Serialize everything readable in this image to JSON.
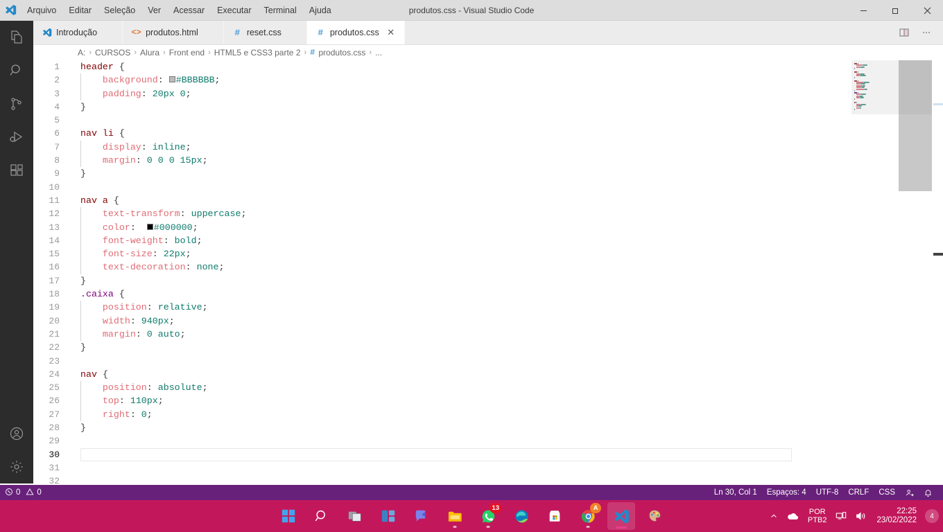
{
  "window": {
    "title": "produtos.css - Visual Studio Code",
    "logo_icon": "vscode-logo-icon",
    "minimize_label": "—",
    "maximize_icon": "maximize-icon",
    "close_label": "✕"
  },
  "menubar": {
    "items": [
      {
        "label": "Arquivo"
      },
      {
        "label": "Editar"
      },
      {
        "label": "Seleção"
      },
      {
        "label": "Ver"
      },
      {
        "label": "Acessar"
      },
      {
        "label": "Executar"
      },
      {
        "label": "Terminal"
      },
      {
        "label": "Ajuda"
      }
    ]
  },
  "activitybar": {
    "items": [
      {
        "name": "explorer",
        "icon": "files-icon",
        "active": false
      },
      {
        "name": "search",
        "icon": "search-icon",
        "active": false
      },
      {
        "name": "source-control",
        "icon": "source-control-icon",
        "active": false
      },
      {
        "name": "run-debug",
        "icon": "run-debug-icon",
        "active": false
      },
      {
        "name": "extensions",
        "icon": "extensions-icon",
        "active": false
      }
    ],
    "bottom": [
      {
        "name": "accounts",
        "icon": "account-icon"
      },
      {
        "name": "settings",
        "icon": "gear-icon"
      }
    ]
  },
  "tabs": [
    {
      "label": "Introdução",
      "icon": "vscode-logo-icon",
      "active": false
    },
    {
      "label": "produtos.html",
      "icon": "html-angle-icon",
      "active": false
    },
    {
      "label": "reset.css",
      "icon": "css-hash-icon",
      "active": false
    },
    {
      "label": "produtos.css",
      "icon": "css-hash-icon",
      "active": true,
      "close_label": "✕"
    }
  ],
  "tab_actions": [
    {
      "name": "split-editor",
      "icon": "split-editor-icon"
    },
    {
      "name": "more-actions",
      "icon": "ellipsis-icon"
    }
  ],
  "breadcrumb": {
    "separator": "›",
    "items": [
      {
        "label": "A:"
      },
      {
        "label": "CURSOS"
      },
      {
        "label": "Alura"
      },
      {
        "label": "Front end"
      },
      {
        "label": "HTML5 e CSS3 parte 2"
      },
      {
        "label": "produtos.css",
        "hash": "#"
      },
      {
        "label": "..."
      }
    ]
  },
  "editor": {
    "language": "css",
    "cursor_line": 30,
    "lines": [
      {
        "n": 1,
        "tokens": [
          {
            "t": "header",
            "c": "sel"
          },
          {
            "t": " ",
            "c": "punc"
          },
          {
            "t": "{",
            "c": "brace"
          }
        ]
      },
      {
        "n": 2,
        "indent": 1,
        "tokens": [
          {
            "t": "    ",
            "c": "punc"
          },
          {
            "t": "background",
            "c": "prop"
          },
          {
            "t": ": ",
            "c": "punc"
          },
          {
            "t": "swatch",
            "c": "color",
            "value": "#BBBBBB"
          },
          {
            "t": "#BBBBBB",
            "c": "val"
          },
          {
            "t": ";",
            "c": "punc"
          }
        ]
      },
      {
        "n": 3,
        "indent": 1,
        "tokens": [
          {
            "t": "    ",
            "c": "punc"
          },
          {
            "t": "padding",
            "c": "prop"
          },
          {
            "t": ": ",
            "c": "punc"
          },
          {
            "t": "20px 0",
            "c": "val"
          },
          {
            "t": ";",
            "c": "punc"
          }
        ]
      },
      {
        "n": 4,
        "tokens": [
          {
            "t": "}",
            "c": "brace"
          }
        ]
      },
      {
        "n": 5,
        "tokens": []
      },
      {
        "n": 6,
        "tokens": [
          {
            "t": "nav li",
            "c": "sel"
          },
          {
            "t": " ",
            "c": "punc"
          },
          {
            "t": "{",
            "c": "brace"
          }
        ]
      },
      {
        "n": 7,
        "indent": 1,
        "tokens": [
          {
            "t": "    ",
            "c": "punc"
          },
          {
            "t": "display",
            "c": "prop"
          },
          {
            "t": ": ",
            "c": "punc"
          },
          {
            "t": "inline",
            "c": "val"
          },
          {
            "t": ";",
            "c": "punc"
          }
        ]
      },
      {
        "n": 8,
        "indent": 1,
        "tokens": [
          {
            "t": "    ",
            "c": "punc"
          },
          {
            "t": "margin",
            "c": "prop"
          },
          {
            "t": ": ",
            "c": "punc"
          },
          {
            "t": "0 0 0 15px",
            "c": "val"
          },
          {
            "t": ";",
            "c": "punc"
          }
        ]
      },
      {
        "n": 9,
        "tokens": [
          {
            "t": "}",
            "c": "brace"
          }
        ]
      },
      {
        "n": 10,
        "tokens": []
      },
      {
        "n": 11,
        "tokens": [
          {
            "t": "nav a",
            "c": "sel"
          },
          {
            "t": " ",
            "c": "punc"
          },
          {
            "t": "{",
            "c": "brace"
          }
        ]
      },
      {
        "n": 12,
        "indent": 1,
        "tokens": [
          {
            "t": "    ",
            "c": "punc"
          },
          {
            "t": "text-transform",
            "c": "prop"
          },
          {
            "t": ": ",
            "c": "punc"
          },
          {
            "t": "uppercase",
            "c": "val"
          },
          {
            "t": ";",
            "c": "punc"
          }
        ]
      },
      {
        "n": 13,
        "indent": 1,
        "tokens": [
          {
            "t": "    ",
            "c": "punc"
          },
          {
            "t": "color",
            "c": "prop"
          },
          {
            "t": ":  ",
            "c": "punc"
          },
          {
            "t": "swatch",
            "c": "color",
            "value": "#000000"
          },
          {
            "t": "#000000",
            "c": "val"
          },
          {
            "t": ";",
            "c": "punc"
          }
        ]
      },
      {
        "n": 14,
        "indent": 1,
        "tokens": [
          {
            "t": "    ",
            "c": "punc"
          },
          {
            "t": "font-weight",
            "c": "prop"
          },
          {
            "t": ": ",
            "c": "punc"
          },
          {
            "t": "bold",
            "c": "val"
          },
          {
            "t": ";",
            "c": "punc"
          }
        ]
      },
      {
        "n": 15,
        "indent": 1,
        "tokens": [
          {
            "t": "    ",
            "c": "punc"
          },
          {
            "t": "font-size",
            "c": "prop"
          },
          {
            "t": ": ",
            "c": "punc"
          },
          {
            "t": "22px",
            "c": "val"
          },
          {
            "t": ";",
            "c": "punc"
          }
        ]
      },
      {
        "n": 16,
        "indent": 1,
        "tokens": [
          {
            "t": "    ",
            "c": "punc"
          },
          {
            "t": "text-decoration",
            "c": "prop"
          },
          {
            "t": ": ",
            "c": "punc"
          },
          {
            "t": "none",
            "c": "val"
          },
          {
            "t": ";",
            "c": "punc"
          }
        ]
      },
      {
        "n": 17,
        "tokens": [
          {
            "t": "}",
            "c": "brace"
          }
        ]
      },
      {
        "n": 18,
        "tokens": [
          {
            "t": ".caixa",
            "c": "selclass"
          },
          {
            "t": " ",
            "c": "punc"
          },
          {
            "t": "{",
            "c": "brace"
          }
        ]
      },
      {
        "n": 19,
        "indent": 1,
        "tokens": [
          {
            "t": "    ",
            "c": "punc"
          },
          {
            "t": "position",
            "c": "prop"
          },
          {
            "t": ": ",
            "c": "punc"
          },
          {
            "t": "relative",
            "c": "val"
          },
          {
            "t": ";",
            "c": "punc"
          }
        ]
      },
      {
        "n": 20,
        "indent": 1,
        "tokens": [
          {
            "t": "    ",
            "c": "punc"
          },
          {
            "t": "width",
            "c": "prop"
          },
          {
            "t": ": ",
            "c": "punc"
          },
          {
            "t": "940px",
            "c": "val"
          },
          {
            "t": ";",
            "c": "punc"
          }
        ]
      },
      {
        "n": 21,
        "indent": 1,
        "tokens": [
          {
            "t": "    ",
            "c": "punc"
          },
          {
            "t": "margin",
            "c": "prop"
          },
          {
            "t": ": ",
            "c": "punc"
          },
          {
            "t": "0 auto",
            "c": "val"
          },
          {
            "t": ";",
            "c": "punc"
          }
        ]
      },
      {
        "n": 22,
        "tokens": [
          {
            "t": "}",
            "c": "brace"
          }
        ]
      },
      {
        "n": 23,
        "tokens": []
      },
      {
        "n": 24,
        "tokens": [
          {
            "t": "nav",
            "c": "sel"
          },
          {
            "t": " ",
            "c": "punc"
          },
          {
            "t": "{",
            "c": "brace"
          }
        ]
      },
      {
        "n": 25,
        "indent": 1,
        "tokens": [
          {
            "t": "    ",
            "c": "punc"
          },
          {
            "t": "position",
            "c": "prop"
          },
          {
            "t": ": ",
            "c": "punc"
          },
          {
            "t": "absolute",
            "c": "val"
          },
          {
            "t": ";",
            "c": "punc"
          }
        ]
      },
      {
        "n": 26,
        "indent": 1,
        "tokens": [
          {
            "t": "    ",
            "c": "punc"
          },
          {
            "t": "top",
            "c": "prop"
          },
          {
            "t": ": ",
            "c": "punc"
          },
          {
            "t": "110px",
            "c": "val"
          },
          {
            "t": ";",
            "c": "punc"
          }
        ]
      },
      {
        "n": 27,
        "indent": 1,
        "tokens": [
          {
            "t": "    ",
            "c": "punc"
          },
          {
            "t": "right",
            "c": "prop"
          },
          {
            "t": ": ",
            "c": "punc"
          },
          {
            "t": "0",
            "c": "val"
          },
          {
            "t": ";",
            "c": "punc"
          }
        ]
      },
      {
        "n": 28,
        "tokens": [
          {
            "t": "}",
            "c": "brace"
          }
        ]
      },
      {
        "n": 29,
        "tokens": []
      },
      {
        "n": 30,
        "tokens": [],
        "current": true
      },
      {
        "n": 31,
        "tokens": []
      },
      {
        "n": 32,
        "tokens": []
      }
    ]
  },
  "statusbar": {
    "errors_icon": "error-circle-icon",
    "errors": "0",
    "warnings_icon": "warning-triangle-icon",
    "warnings": "0",
    "cursor_position": "Ln 30, Col 1",
    "indentation": "Espaços: 4",
    "encoding": "UTF-8",
    "eol": "CRLF",
    "language_mode": "CSS",
    "feedback_icon": "feedback-icon",
    "notifications_icon": "bell-icon"
  },
  "taskbar": {
    "items": [
      {
        "name": "start",
        "icon": "windows-start-icon"
      },
      {
        "name": "search",
        "icon": "search-icon"
      },
      {
        "name": "task-view",
        "icon": "task-view-icon"
      },
      {
        "name": "widgets",
        "icon": "widgets-icon"
      },
      {
        "name": "teams",
        "icon": "teams-chat-icon"
      },
      {
        "name": "file-explorer",
        "icon": "file-explorer-icon",
        "running": true
      },
      {
        "name": "whatsapp",
        "icon": "whatsapp-icon",
        "badge": "13",
        "running": true
      },
      {
        "name": "edge",
        "icon": "edge-icon"
      },
      {
        "name": "microsoft-store",
        "icon": "store-icon"
      },
      {
        "name": "chrome",
        "icon": "chrome-icon",
        "badge": "A",
        "badge_style": "orange",
        "running": true
      },
      {
        "name": "vscode",
        "icon": "vscode-logo-icon",
        "active": true
      },
      {
        "name": "paint",
        "icon": "paint-icon"
      }
    ],
    "tray": {
      "chevron_icon": "chevron-up-icon",
      "onedrive_icon": "onedrive-cloud-icon",
      "language_top": "POR",
      "language_bottom": "PTB2",
      "network_icon": "network-icon",
      "volume_icon": "volume-icon",
      "time": "22:25",
      "date": "23/02/2022",
      "notification_count": "4"
    }
  }
}
